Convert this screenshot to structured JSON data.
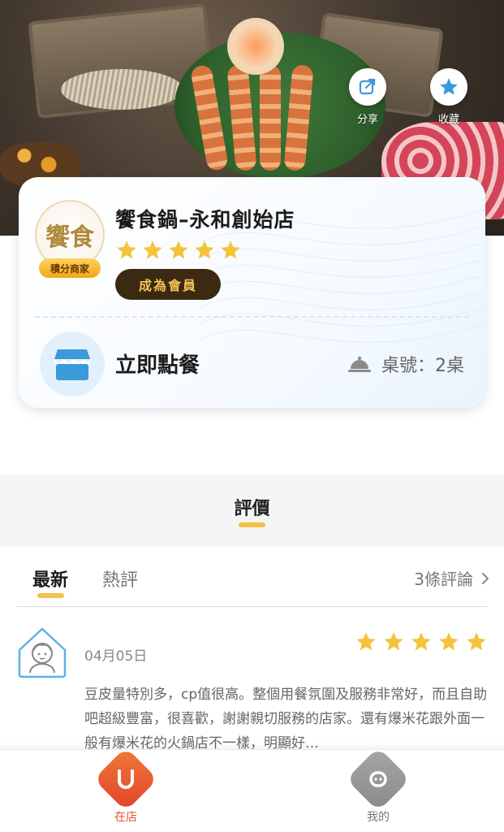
{
  "hero": {
    "share_label": "分享",
    "favorite_label": "收藏"
  },
  "store": {
    "name": "饗食鍋–永和創始店",
    "logo_text": "饗食",
    "badge": "積分商家",
    "rating": 5,
    "member_button": "成為會員",
    "order_label": "立即點餐",
    "table_label": "桌號：2桌"
  },
  "reviews_section": {
    "title": "評價",
    "tabs": [
      "最新",
      "熱評"
    ],
    "active_tab": "最新",
    "count_link": "3條評論",
    "items": [
      {
        "date": "04月05日",
        "rating": 5,
        "text": "豆皮量特別多，cp值很高。整個用餐氛圍及服務非常好，而且自助吧超級豐富，很喜歡，謝謝親切服務的店家。還有爆米花跟外面一般有爆米花的火鍋店不一樣，明顯好…"
      }
    ]
  },
  "bottom_nav": {
    "items": [
      {
        "label": "在店",
        "active": true
      },
      {
        "label": "我的",
        "active": false
      }
    ]
  },
  "colors": {
    "accent_yellow": "#f3c246",
    "star": "#f5c33b",
    "active_nav": "#e8542a",
    "inactive_nav": "#9a9a9a",
    "member_button_bg": "#3a2a12",
    "member_button_text": "#f3c453",
    "icon_blue": "#3b9ad9"
  }
}
